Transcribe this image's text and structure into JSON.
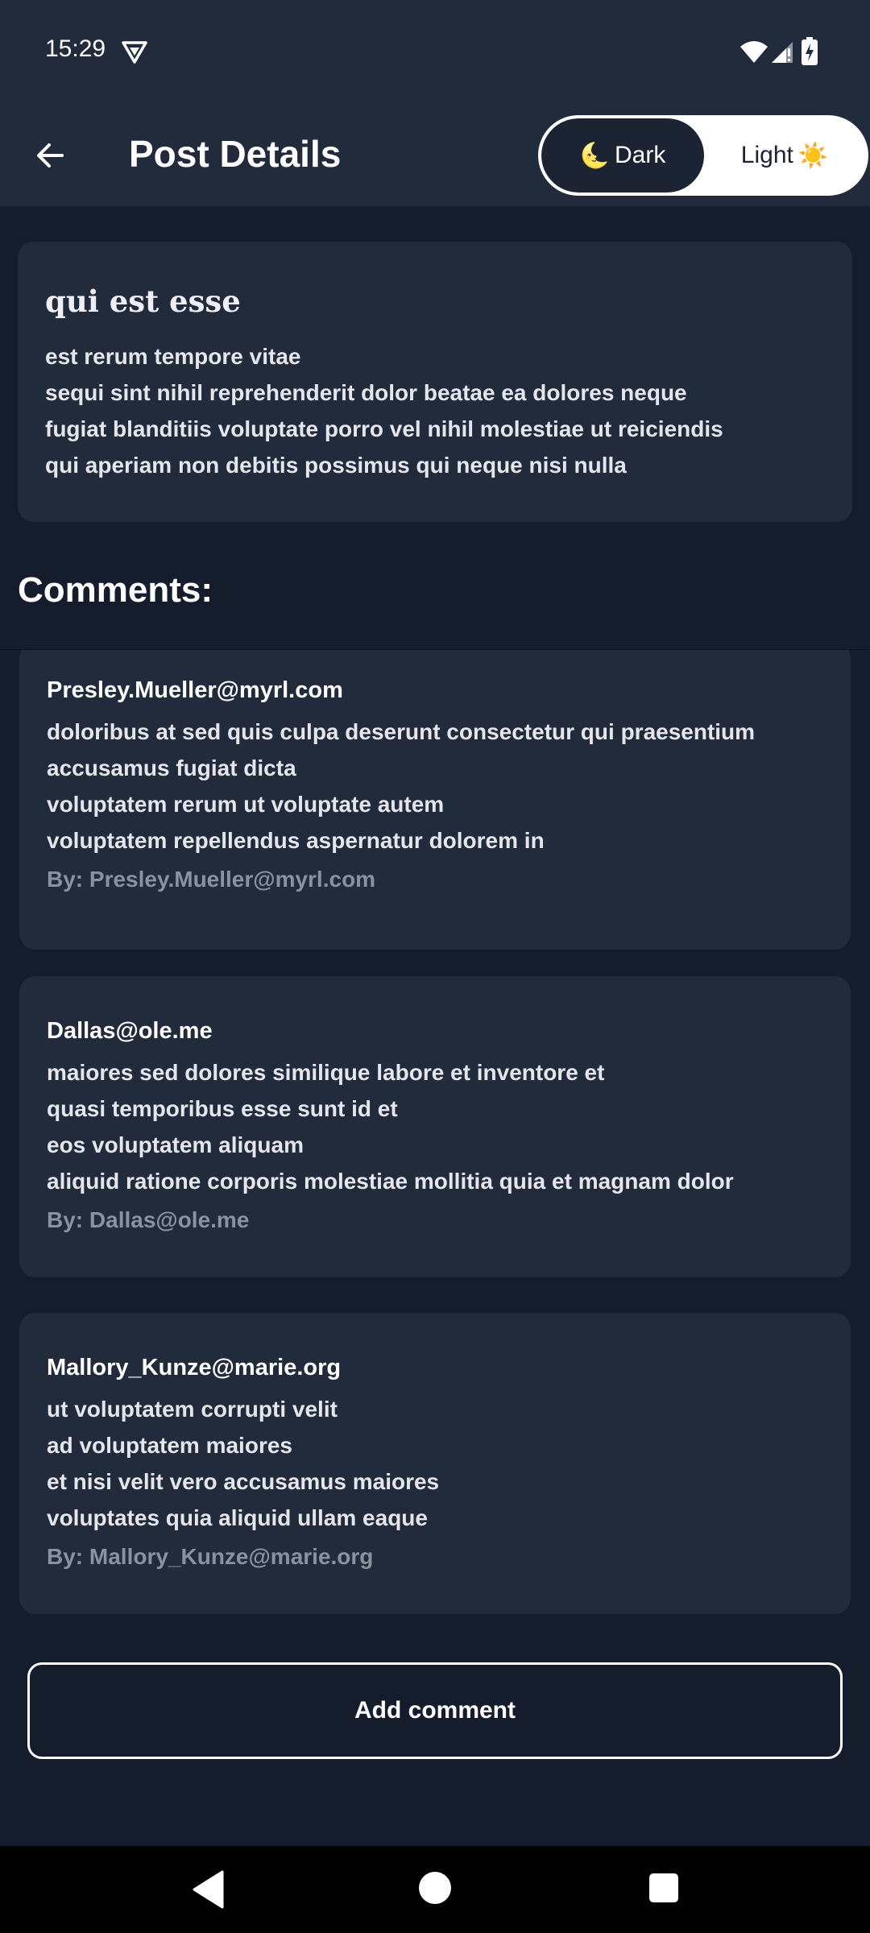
{
  "status_bar": {
    "time": "15:29",
    "icons": [
      "vpn-icon",
      "wifi-icon",
      "signal-icon",
      "battery-icon"
    ]
  },
  "app_bar": {
    "title": "Post Details",
    "back_icon": "arrow-left-icon",
    "theme_toggle": {
      "dark_label": "Dark",
      "light_label": "Light",
      "dark_icon": "🌜",
      "light_icon": "☀️",
      "selected": "Dark"
    }
  },
  "post": {
    "title": "qui est esse",
    "body": "est rerum tempore vitae\nsequi sint nihil reprehenderit dolor beatae ea dolores neque\nfugiat blanditiis voluptate porro vel nihil molestiae ut reiciendis\nqui aperiam non debitis possimus qui neque nisi nulla"
  },
  "comments_heading": "Comments:",
  "comments": [
    {
      "email": "Presley.Mueller@myrl.com",
      "body": "doloribus at sed quis culpa deserunt consectetur qui praesentium\naccusamus fugiat dicta\nvoluptatem rerum ut voluptate autem\nvoluptatem repellendus aspernatur dolorem in",
      "by": "By: Presley.Mueller@myrl.com"
    },
    {
      "email": "Dallas@ole.me",
      "body": "maiores sed dolores similique labore et inventore et\nquasi temporibus esse sunt id et\neos voluptatem aliquam\naliquid ratione corporis molestiae mollitia quia et magnam dolor",
      "by": "By: Dallas@ole.me"
    },
    {
      "email": "Mallory_Kunze@marie.org",
      "body": "ut voluptatem corrupti velit\nad voluptatem maiores\net nisi velit vero accusamus maiores\nvoluptates quia aliquid ullam eaque",
      "by": "By: Mallory_Kunze@marie.org"
    }
  ],
  "add_comment_label": "Add comment",
  "colors": {
    "background": "#151c2b",
    "surface": "#222b3b",
    "text": "#ffffff",
    "muted": "#8a92a0"
  }
}
